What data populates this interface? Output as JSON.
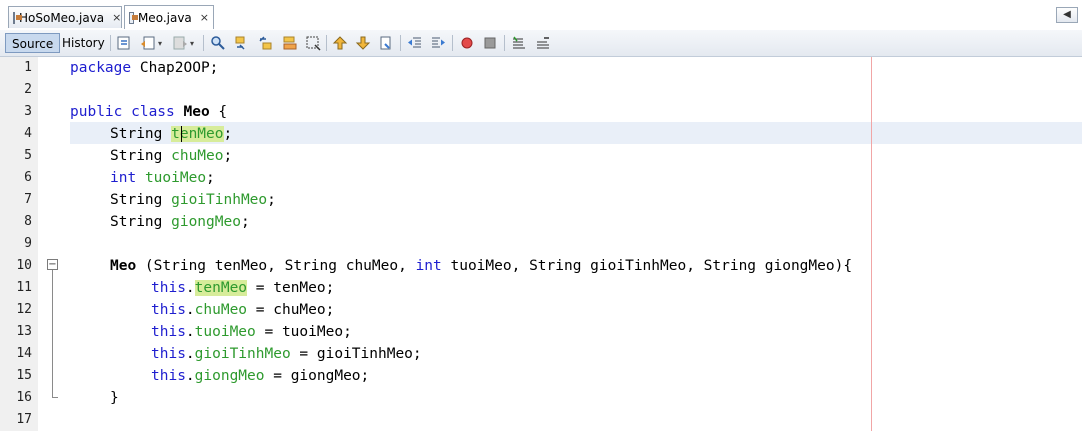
{
  "tabs": [
    {
      "label": "HoSoMeo.java",
      "close": "×"
    },
    {
      "label": "Meo.java",
      "close": "×"
    }
  ],
  "toolbar": {
    "source_label": "Source",
    "history_label": "History",
    "icons": [
      "last-edit-icon",
      "back-icon",
      "forward-icon",
      "find-selection-icon",
      "find-previous-icon",
      "find-next-icon",
      "toggle-highlight-icon",
      "toggle-rect-selection-icon",
      "previous-bookmark-icon",
      "next-bookmark-icon",
      "toggle-bookmark-icon",
      "shift-left-icon",
      "shift-right-icon",
      "start-macro-icon",
      "stop-macro-icon",
      "comment-icon",
      "uncomment-icon"
    ]
  },
  "gutter": {
    "line_numbers": [
      "1",
      "2",
      "3",
      "4",
      "5",
      "6",
      "7",
      "8",
      "9",
      "10",
      "11",
      "12",
      "13",
      "14",
      "15",
      "16",
      "17"
    ]
  },
  "code": {
    "l1_kw": "package",
    "l1_rest": " Chap2OOP;",
    "l3_kw": "public class",
    "l3_name": "Meo",
    "l3_rest": " {",
    "l4_type": "String ",
    "l4_field": "tenMeo",
    "l4_end": ";",
    "l5_type": "String ",
    "l5_field": "chuMeo",
    "l5_end": ";",
    "l6_type": "int",
    "l6_sp": " ",
    "l6_field": "tuoiMeo",
    "l6_end": ";",
    "l7_type": "String ",
    "l7_field": "gioiTinhMeo",
    "l7_end": ";",
    "l8_type": "String ",
    "l8_field": "giongMeo",
    "l8_end": ";",
    "l10_name": "Meo",
    "l10_a": " (String tenMeo, String chuMeo, ",
    "l10_int": "int",
    "l10_b": " tuoiMeo, String gioiTinhMeo, String giongMeo){",
    "l11_this": "this",
    "l11_dot": ".",
    "l11_field": "tenMeo",
    "l11_rest": " = tenMeo;",
    "l12_this": "this",
    "l12_dot": ".",
    "l12_field": "chuMeo",
    "l12_rest": " = chuMeo;",
    "l13_this": "this",
    "l13_dot": ".",
    "l13_field": "tuoiMeo",
    "l13_rest": " = tuoiMeo;",
    "l14_this": "this",
    "l14_dot": ".",
    "l14_field": "gioiTinhMeo",
    "l14_rest": " = gioiTinhMeo;",
    "l15_this": "this",
    "l15_dot": ".",
    "l15_field": "giongMeo",
    "l15_rest": " = giongMeo;",
    "l16": "}"
  },
  "fold_symbol": "−",
  "nav_symbol": "◀"
}
